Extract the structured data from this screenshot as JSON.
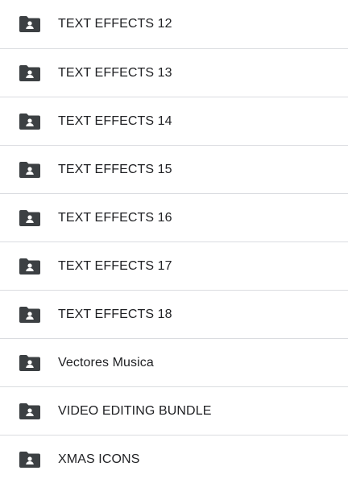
{
  "folders": [
    {
      "name": "TEXT EFFECTS 12",
      "icon": "shared-folder-icon"
    },
    {
      "name": "TEXT EFFECTS 13",
      "icon": "shared-folder-icon"
    },
    {
      "name": "TEXT EFFECTS 14",
      "icon": "shared-folder-icon"
    },
    {
      "name": "TEXT EFFECTS 15",
      "icon": "shared-folder-icon"
    },
    {
      "name": "TEXT EFFECTS 16",
      "icon": "shared-folder-icon"
    },
    {
      "name": "TEXT EFFECTS 17",
      "icon": "shared-folder-icon"
    },
    {
      "name": "TEXT EFFECTS 18",
      "icon": "shared-folder-icon"
    },
    {
      "name": "Vectores Musica",
      "icon": "shared-folder-icon"
    },
    {
      "name": "VIDEO EDITING BUNDLE",
      "icon": "shared-folder-icon"
    },
    {
      "name": "XMAS ICONS",
      "icon": "shared-folder-icon"
    }
  ],
  "colors": {
    "icon": "#3c4043",
    "text": "#202124",
    "divider": "#dadce0"
  }
}
